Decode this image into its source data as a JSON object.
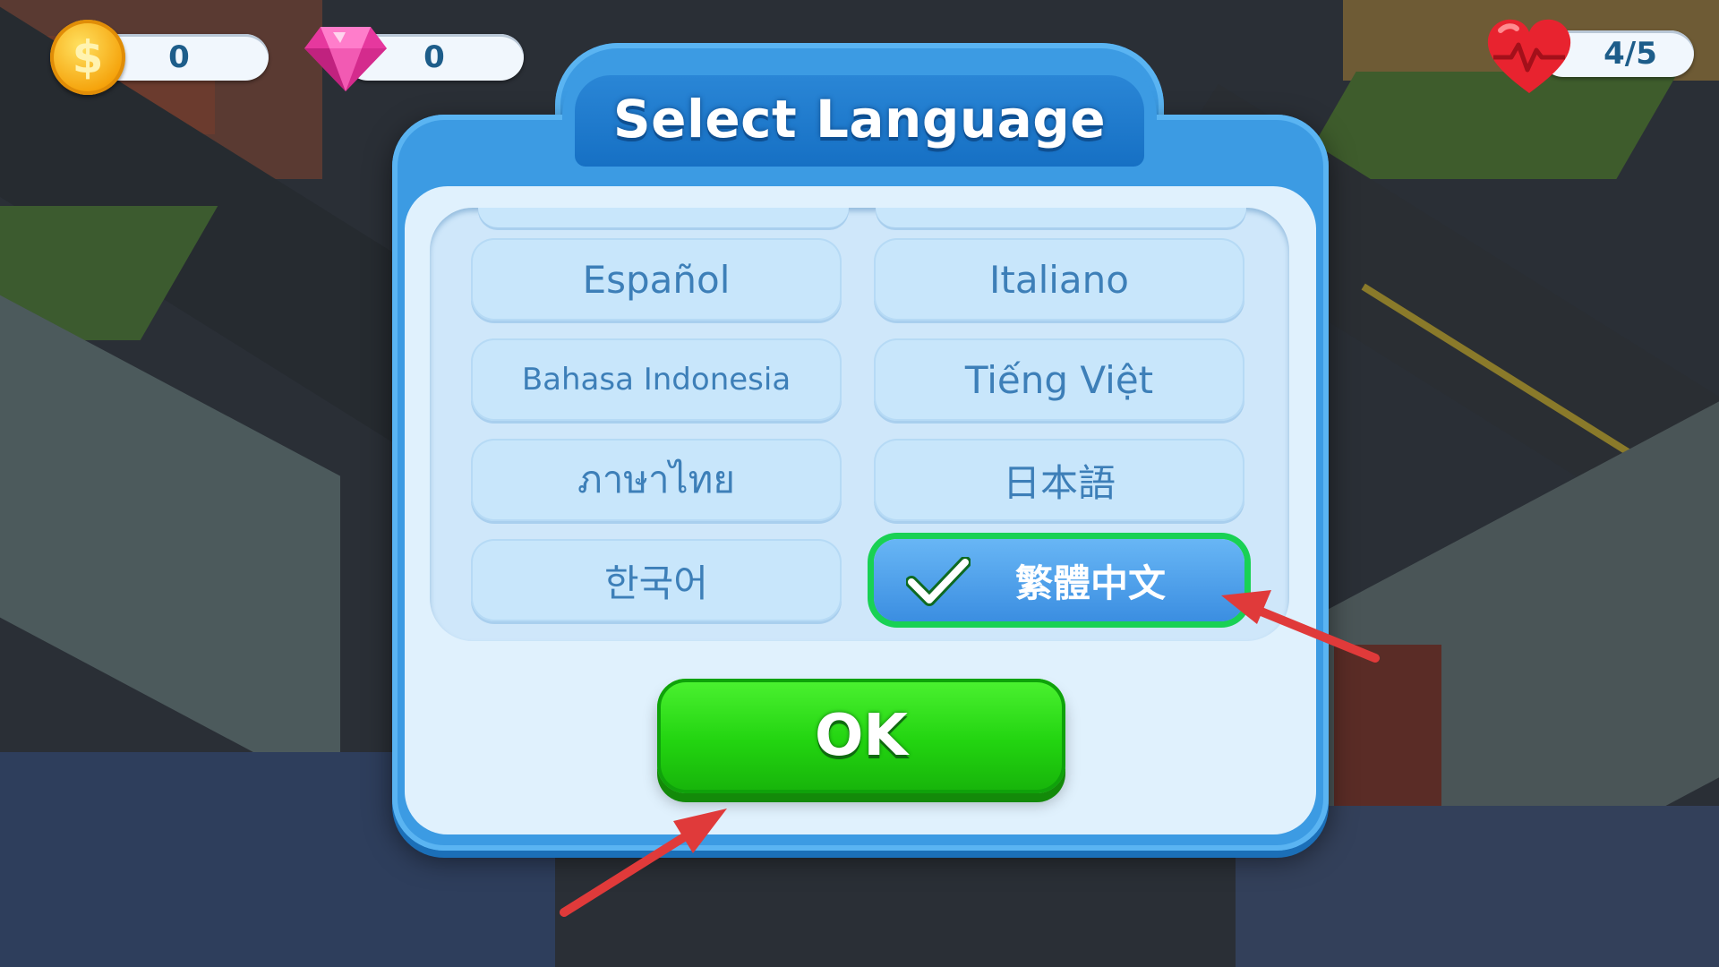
{
  "hud": {
    "coins": "0",
    "gems": "0",
    "lives": "4/5",
    "coin_symbol": "$"
  },
  "dialog": {
    "title": "Select Language",
    "languages": [
      {
        "label": "Español",
        "selected": false
      },
      {
        "label": "Italiano",
        "selected": false
      },
      {
        "label": "Bahasa Indonesia",
        "selected": false
      },
      {
        "label": "Tiếng Việt",
        "selected": false
      },
      {
        "label": "ภาษาไทย",
        "selected": false
      },
      {
        "label": "日本語",
        "selected": false
      },
      {
        "label": "한국어",
        "selected": false
      },
      {
        "label": "繁體中文",
        "selected": true
      }
    ],
    "ok_label": "OK"
  },
  "colors": {
    "dialog_blue": "#3c9be3",
    "selected_border": "#19d154",
    "ok_green": "#22d410",
    "annotation_arrow": "#e03a3a"
  },
  "icons": [
    "coin-icon",
    "gem-icon",
    "heart-icon",
    "checkmark-icon",
    "annotation-arrow"
  ]
}
